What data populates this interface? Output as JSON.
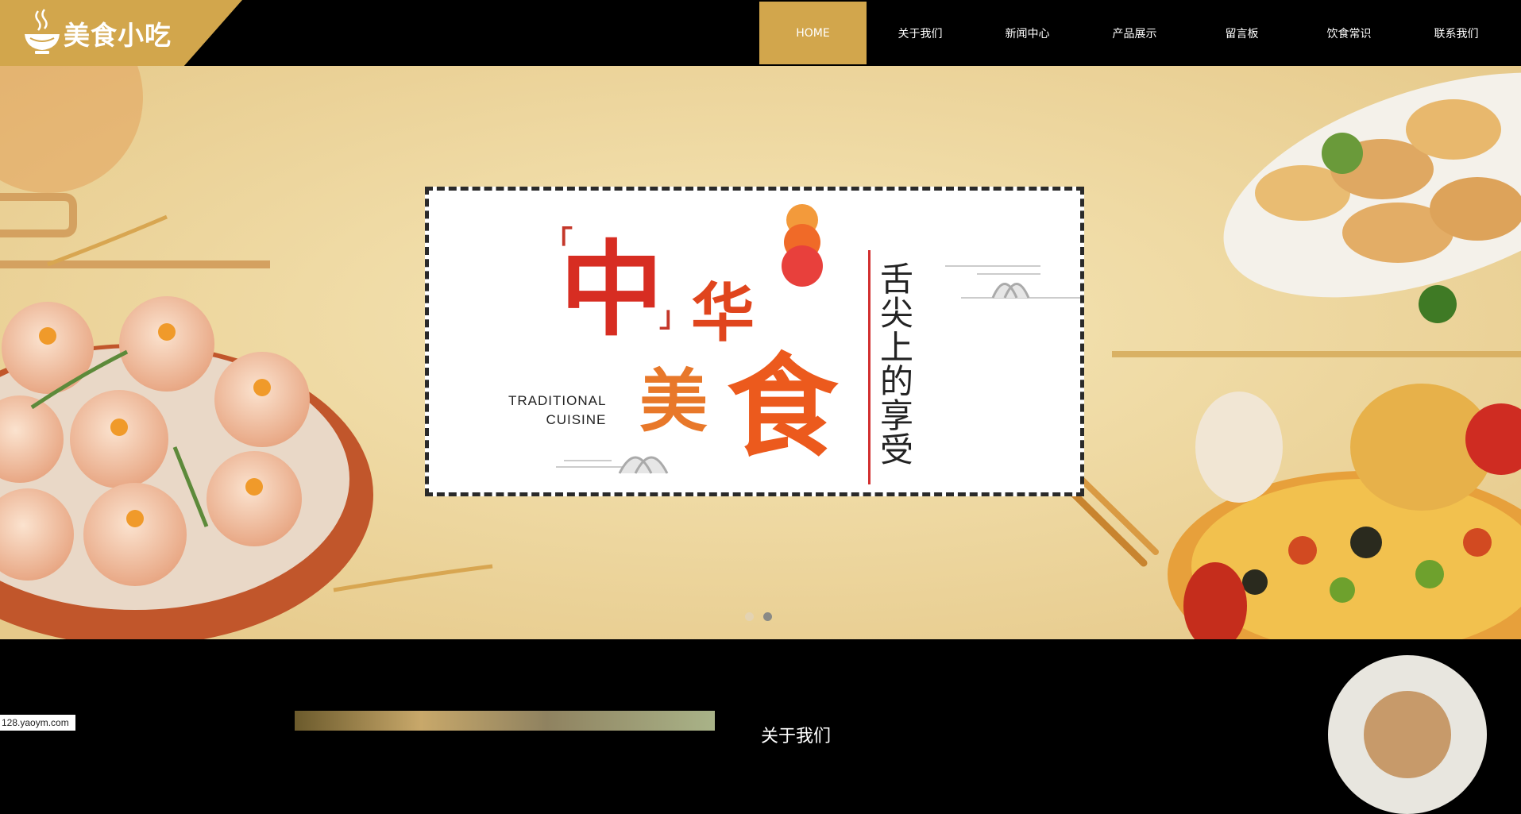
{
  "brand": {
    "name": "美食小吃",
    "icon": "noodle-bowl-icon",
    "accent": "#d2a64c"
  },
  "nav": {
    "items": [
      {
        "label": "HOME",
        "active": true
      },
      {
        "label": "关于我们",
        "active": false
      },
      {
        "label": "新闻中心",
        "active": false
      },
      {
        "label": "产品展示",
        "active": false
      },
      {
        "label": "留言板",
        "active": false
      },
      {
        "label": "饮食常识",
        "active": false
      },
      {
        "label": "联系我们",
        "active": false
      }
    ]
  },
  "banner": {
    "headline_chars": [
      "中",
      "华",
      "美",
      "食"
    ],
    "bracket_open": "「",
    "bracket_close": "」",
    "english_line1": "TRADITIONAL",
    "english_line2": "CUISINE",
    "vertical_text": "舌尖上的享受",
    "slides": [
      {
        "active": false
      },
      {
        "active": true
      }
    ]
  },
  "about": {
    "heading": "关于我们"
  },
  "watermark": "128.yaoym.com"
}
